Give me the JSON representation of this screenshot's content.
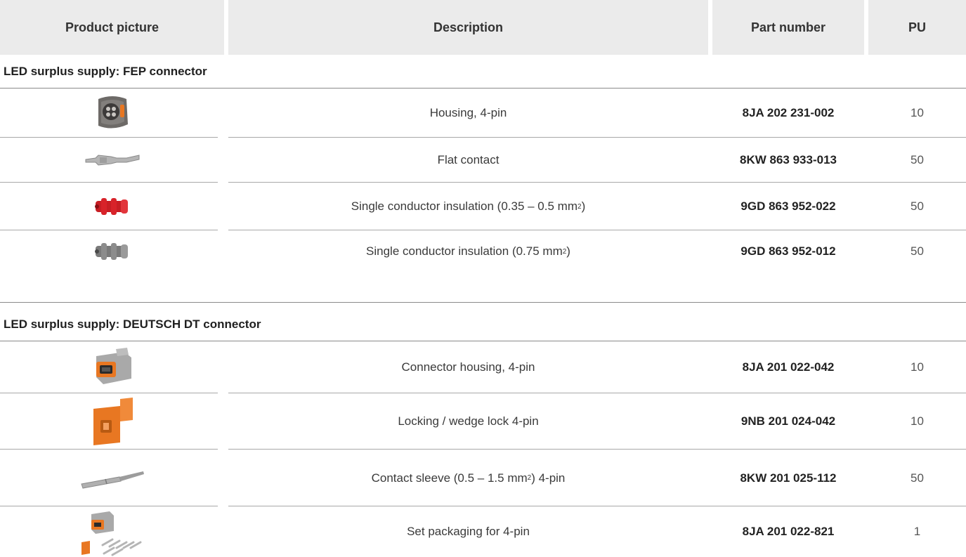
{
  "header": {
    "product_picture": "Product picture",
    "description": "Description",
    "part_number": "Part number",
    "pu": "PU"
  },
  "sections": [
    {
      "title": "LED surplus supply: FEP connector",
      "rows": [
        {
          "image": "grey-housing-4pin-icon",
          "description": "Housing, 4-pin",
          "part_number": "8JA 202 231-002",
          "pu": "10"
        },
        {
          "image": "flat-contact-icon",
          "description": "Flat contact",
          "part_number": "8KW 863 933-013",
          "pu": "50"
        },
        {
          "image": "red-seal-icon",
          "description_main": "Single conductor insulation (0.35 – 0.5 mm",
          "description_sup": "2",
          "description_end": ")",
          "part_number": "9GD 863 952-022",
          "pu": "50"
        },
        {
          "image": "grey-seal-icon",
          "description_main": "Single conductor insulation (0.75 mm",
          "description_sup": "2",
          "description_end": ")",
          "part_number": "9GD 863 952-012",
          "pu": "50"
        }
      ]
    },
    {
      "title": "LED surplus supply: DEUTSCH DT connector",
      "rows": [
        {
          "image": "dt-connector-housing-icon",
          "description": "Connector housing, 4-pin",
          "part_number": "8JA 201 022-042",
          "pu": "10"
        },
        {
          "image": "wedge-lock-icon",
          "description": "Locking / wedge lock 4-pin",
          "part_number": "9NB 201 024-042",
          "pu": "10"
        },
        {
          "image": "contact-sleeve-icon",
          "description_main": "Contact sleeve (0.5 – 1.5 mm",
          "description_sup": "2",
          "description_end": ") 4-pin",
          "part_number": "8KW 201 025-112",
          "pu": "50"
        },
        {
          "image": "set-packaging-icon",
          "description": "Set packaging for 4-pin",
          "part_number": "8JA 201 022-821",
          "pu": "1"
        }
      ]
    }
  ],
  "colors": {
    "header_bg": "#ebebeb",
    "orange": "#e87722",
    "red": "#d8232a",
    "grey_part": "#8c8c8c"
  }
}
